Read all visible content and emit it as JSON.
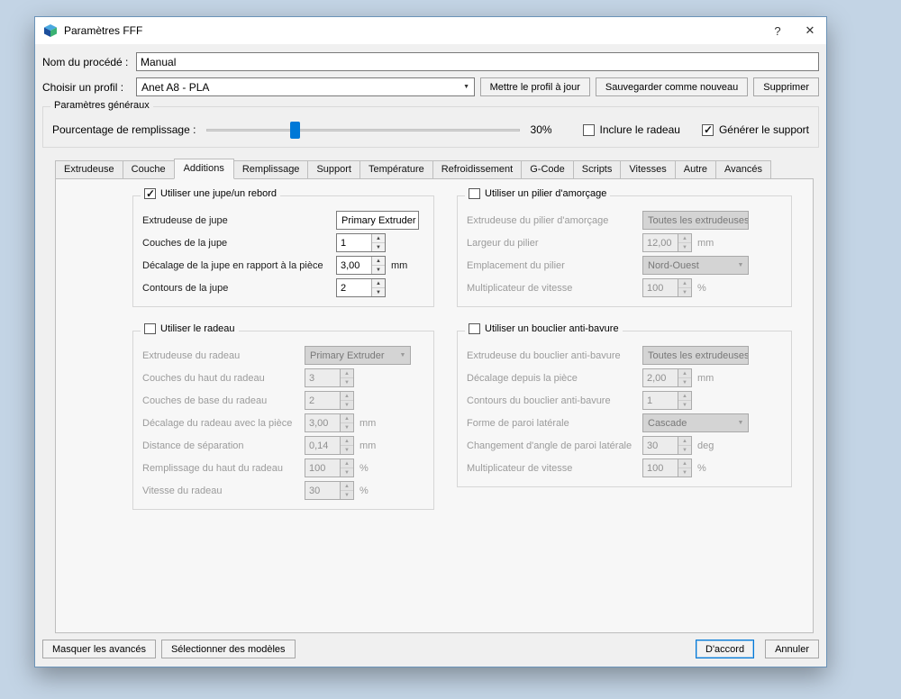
{
  "window": {
    "title": "Paramètres FFF",
    "help_button": "?",
    "close_button": "✕"
  },
  "header": {
    "process_name_label": "Nom du procédé :",
    "process_name_value": "Manual",
    "profile_label": "Choisir un profil :",
    "profile_value": "Anet A8 - PLA",
    "update_profile_button": "Mettre le profil à jour",
    "save_as_new_button": "Sauvegarder comme nouveau",
    "delete_button": "Supprimer"
  },
  "general": {
    "title": "Paramètres généraux",
    "infill_label": "Pourcentage de remplissage :",
    "infill_value": "30%",
    "infill_percent": 30,
    "include_raft_label": "Inclure le radeau",
    "include_raft_checked": false,
    "generate_support_label": "Générer le support",
    "generate_support_checked": true
  },
  "tabs": {
    "items": [
      "Extrudeuse",
      "Couche",
      "Additions",
      "Remplissage",
      "Support",
      "Température",
      "Refroidissement",
      "G-Code",
      "Scripts",
      "Vitesses",
      "Autre",
      "Avancés"
    ],
    "active": "Additions"
  },
  "groups": {
    "skirt": {
      "title": "Utiliser une jupe/un rebord",
      "enabled": true,
      "rows": [
        {
          "label": "Extrudeuse de jupe",
          "value": "Primary Extruder",
          "control": "dropdown"
        },
        {
          "label": "Couches de la jupe",
          "value": "1",
          "control": "spinner"
        },
        {
          "label": "Décalage de la jupe en rapport à la pièce",
          "value": "3,00",
          "unit": "mm",
          "control": "spinner"
        },
        {
          "label": "Contours de la jupe",
          "value": "2",
          "control": "spinner"
        }
      ]
    },
    "pillar": {
      "title": "Utiliser un pilier d'amorçage",
      "enabled": false,
      "rows": [
        {
          "label": "Extrudeuse du pilier d'amorçage",
          "value": "Toutes les extrudeuses",
          "control": "dropdown"
        },
        {
          "label": "Largeur du pilier",
          "value": "12,00",
          "unit": "mm",
          "control": "spinner"
        },
        {
          "label": "Emplacement du pilier",
          "value": "Nord-Ouest",
          "control": "dropdown"
        },
        {
          "label": "Multiplicateur de vitesse",
          "value": "100",
          "unit": "%",
          "control": "spinner"
        }
      ]
    },
    "raft": {
      "title": "Utiliser le radeau",
      "enabled": false,
      "rows": [
        {
          "label": "Extrudeuse du radeau",
          "value": "Primary Extruder",
          "control": "dropdown"
        },
        {
          "label": "Couches du haut du radeau",
          "value": "3",
          "control": "spinner"
        },
        {
          "label": "Couches de base du radeau",
          "value": "2",
          "control": "spinner"
        },
        {
          "label": "Décalage du radeau avec la pièce",
          "value": "3,00",
          "unit": "mm",
          "control": "spinner"
        },
        {
          "label": "Distance de séparation",
          "value": "0,14",
          "unit": "mm",
          "control": "spinner"
        },
        {
          "label": "Remplissage du haut du radeau",
          "value": "100",
          "unit": "%",
          "control": "spinner"
        },
        {
          "label": "Vitesse du radeau",
          "value": "30",
          "unit": "%",
          "control": "spinner"
        }
      ]
    },
    "ooze": {
      "title": "Utiliser un bouclier anti-bavure",
      "enabled": false,
      "rows": [
        {
          "label": "Extrudeuse du bouclier anti-bavure",
          "value": "Toutes les extrudeuses",
          "control": "dropdown"
        },
        {
          "label": "Décalage depuis la pièce",
          "value": "2,00",
          "unit": "mm",
          "control": "spinner"
        },
        {
          "label": "Contours du bouclier anti-bavure",
          "value": "1",
          "control": "spinner"
        },
        {
          "label": "Forme de paroi latérale",
          "value": "Cascade",
          "control": "dropdown"
        },
        {
          "label": "Changement d'angle de paroi latérale",
          "value": "30",
          "unit": "deg",
          "control": "spinner"
        },
        {
          "label": "Multiplicateur de vitesse",
          "value": "100",
          "unit": "%",
          "control": "spinner"
        }
      ]
    }
  },
  "footer": {
    "hide_advanced_button": "Masquer les avancés",
    "select_models_button": "Sélectionner des modèles",
    "ok_button": "D'accord",
    "cancel_button": "Annuler"
  },
  "colors": {
    "accent": "#0078d7",
    "desktop": "#c3d4e5"
  }
}
